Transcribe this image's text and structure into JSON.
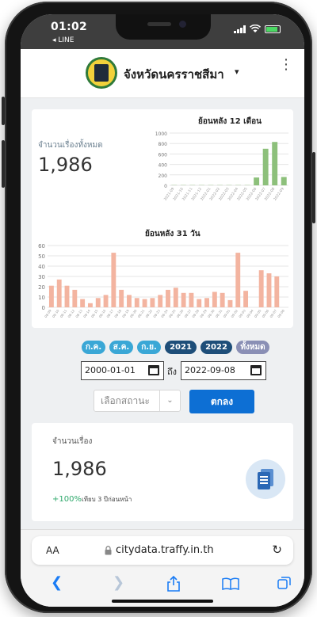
{
  "status": {
    "time": "01:02",
    "back_app": "◂ LINE"
  },
  "header": {
    "province": "จังหวัดนครราชสีมา",
    "caret": "▾",
    "menu": "⋮"
  },
  "summary_card": {
    "total_label": "จำนวนเรื่องทั้งหมด",
    "total_value": "1,986"
  },
  "chart_data": [
    {
      "type": "bar",
      "title": "ย้อนหลัง 12 เดือน",
      "ylim": [
        0,
        1000
      ],
      "yticks": [
        "0",
        "200",
        "400",
        "600",
        "800",
        "1000"
      ],
      "categories": [
        "2021-09",
        "2021-10",
        "2021-11",
        "2021-12",
        "2022-01",
        "2022-02",
        "2022-03",
        "2022-04",
        "2022-05",
        "2022-06",
        "2022-07",
        "2022-08",
        "2022-09"
      ],
      "values": [
        5,
        5,
        5,
        5,
        5,
        5,
        5,
        5,
        5,
        150,
        700,
        830,
        160
      ],
      "color": "#8dc07b"
    },
    {
      "type": "bar",
      "title": "ย้อนหลัง 31 วัน",
      "ylim": [
        0,
        60
      ],
      "yticks": [
        "0",
        "10",
        "20",
        "30",
        "40",
        "50",
        "60"
      ],
      "categories": [
        "08-09",
        "08-10",
        "08-11",
        "08-12",
        "08-13",
        "08-14",
        "08-15",
        "08-16",
        "08-17",
        "08-18",
        "08-19",
        "08-20",
        "08-21",
        "08-22",
        "08-23",
        "08-24",
        "08-25",
        "08-26",
        "08-27",
        "08-28",
        "08-29",
        "08-30",
        "08-31",
        "09-01",
        "09-02",
        "09-03",
        "09-04",
        "09-05",
        "09-06",
        "09-07",
        "09-08"
      ],
      "values": [
        21,
        27,
        21,
        17,
        8,
        4,
        9,
        12,
        53,
        17,
        12,
        9,
        8,
        9,
        12,
        17,
        19,
        14,
        14,
        8,
        9,
        15,
        14,
        7,
        53,
        16,
        0,
        36,
        33,
        30,
        0
      ],
      "color": "#f3b4a0"
    }
  ],
  "filters": {
    "pills": [
      "ก.ค.",
      "ส.ค.",
      "ก.ย.",
      "2021",
      "2022",
      "ทั้งหมด"
    ],
    "start_date": "2000-01-01",
    "to_label": "ถึง",
    "end_date": "2022-09-08",
    "status_placeholder": "เลือกสถานะ",
    "submit_label": "ตกลง"
  },
  "count_card": {
    "title": "จำนวนเรื่อง",
    "value": "1,986",
    "change": "+100%",
    "compare": "เทียบ 3 ปีก่อนหน้า"
  },
  "browser": {
    "aa": "AA",
    "url": "citydata.traffy.in.th"
  }
}
